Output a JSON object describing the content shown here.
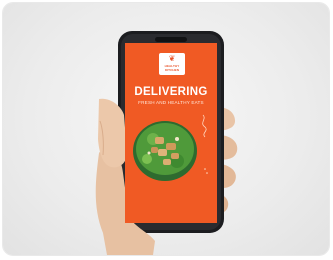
{
  "photo": {
    "description_free": true,
    "background": "#ececec"
  },
  "phone": {
    "screen_color": "#f05a24",
    "logo_icon": "leaf-icon",
    "logo_text": "HEALTHY\nKITCHEN",
    "headline": "DELIVERING",
    "subline": "FRESH AND HEALTHY EATS"
  }
}
